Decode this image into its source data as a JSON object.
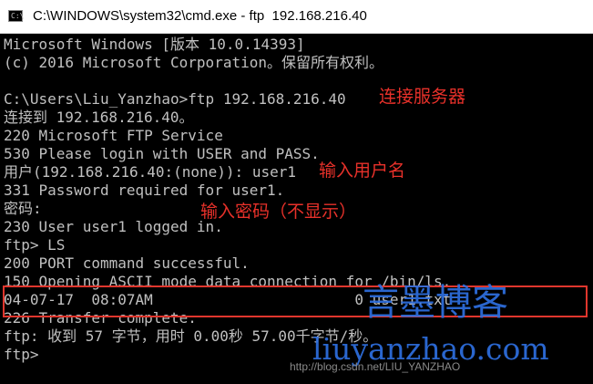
{
  "window": {
    "title": "C:\\WINDOWS\\system32\\cmd.exe - ftp  192.168.216.40",
    "icon": "cmd-icon",
    "icon_prompt": "C:\\"
  },
  "console": {
    "lines": [
      "Microsoft Windows [版本 10.0.14393]",
      "(c) 2016 Microsoft Corporation。保留所有权利。",
      "",
      "C:\\Users\\Liu_Yanzhao>ftp 192.168.216.40",
      "连接到 192.168.216.40。",
      "220 Microsoft FTP Service",
      "530 Please login with USER and PASS.",
      "用户(192.168.216.40:(none)): user1",
      "331 Password required for user1.",
      "密码:",
      "230 User user1 logged in.",
      "ftp> LS",
      "200 PORT command successful.",
      "150 Opening ASCII mode data connection for /bin/ls.",
      "04-07-17  08:07AM                       0 user1.txt",
      "226 Transfer complete.",
      "ftp: 收到 57 字节，用时 0.00秒 57.00千字节/秒。",
      "ftp>"
    ]
  },
  "annotations": {
    "connect": "连接服务器",
    "username": "输入用户名",
    "password": "输入密码（不显示）"
  },
  "watermarks": {
    "blog_name": "言墨博客",
    "site": "liuyanzhao.com",
    "csdn": "http://blog.csdn.net/LIU_YANZHAO"
  },
  "colors": {
    "console_bg": "#000000",
    "console_text": "#c0c0c0",
    "annotation_red": "#e8312a",
    "watermark_blue": "#2e6fe0"
  }
}
